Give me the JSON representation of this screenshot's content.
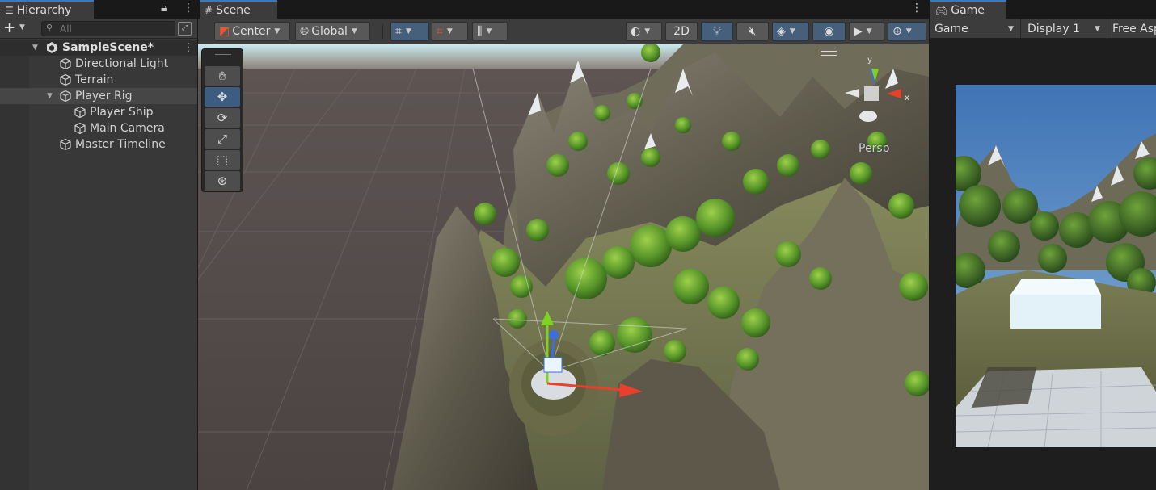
{
  "hierarchy": {
    "tab_label": "Hierarchy",
    "search_placeholder": "All",
    "scene_name": "SampleScene*",
    "items": [
      {
        "label": "Directional Light"
      },
      {
        "label": "Terrain"
      },
      {
        "label": "Player Rig"
      },
      {
        "label": "Player Ship"
      },
      {
        "label": "Main Camera"
      },
      {
        "label": "Master Timeline"
      }
    ]
  },
  "scene": {
    "tab_label": "Scene",
    "pivot_mode": "Center",
    "pivot_rotation": "Global",
    "toggle_2d": "2D",
    "projection_label": "Persp",
    "gizmo_axis_x": "x",
    "gizmo_axis_y": "y"
  },
  "game": {
    "tab_label": "Game",
    "view_mode": "Game",
    "display": "Display 1",
    "aspect": "Free Aspect"
  },
  "colors": {
    "selection_accent": "#3a79bb",
    "active_button": "#46607c",
    "axis_x": "#e8402a",
    "axis_y": "#7ed321",
    "axis_z": "#3c6ee0"
  }
}
